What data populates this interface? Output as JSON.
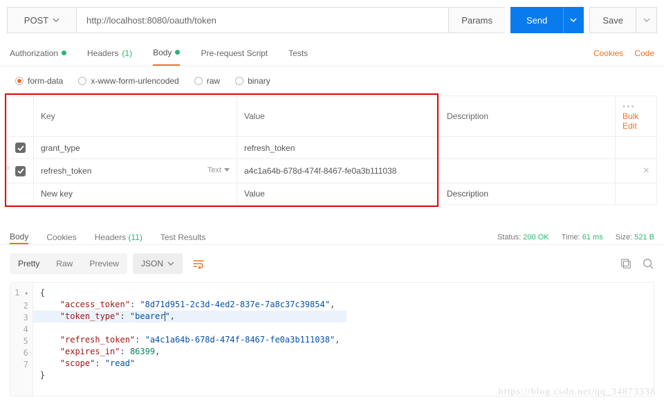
{
  "request": {
    "method": "POST",
    "url": "http://localhost:8080/oauth/token",
    "params_btn": "Params",
    "send_btn": "Send",
    "save_btn": "Save"
  },
  "req_tabs": {
    "authorization": "Authorization",
    "headers": "Headers",
    "headers_count": "(1)",
    "body": "Body",
    "prerequest": "Pre-request Script",
    "tests": "Tests",
    "cookies_link": "Cookies",
    "code_link": "Code"
  },
  "body_types": {
    "form_data": "form-data",
    "xwww": "x-www-form-urlencoded",
    "raw": "raw",
    "binary": "binary"
  },
  "fd": {
    "headers": {
      "key": "Key",
      "value": "Value",
      "desc": "Description",
      "bulk": "Bulk Edit"
    },
    "rows": [
      {
        "key": "grant_type",
        "value": "refresh_token"
      },
      {
        "key": "refresh_token",
        "value": "a4c1a64b-678d-474f-8467-fe0a3b111038",
        "type": "Text"
      }
    ],
    "placeholders": {
      "key": "New key",
      "value": "Value",
      "desc": "Description"
    }
  },
  "resp_tabs": {
    "body": "Body",
    "cookies": "Cookies",
    "headers": "Headers",
    "headers_count": "(11)",
    "tests": "Test Results"
  },
  "resp_meta": {
    "status_lbl": "Status:",
    "status_val": "200 OK",
    "time_lbl": "Time:",
    "time_val": "61 ms",
    "size_lbl": "Size:",
    "size_val": "521 B"
  },
  "resp_toolbar": {
    "pretty": "Pretty",
    "raw": "Raw",
    "preview": "Preview",
    "lang": "JSON"
  },
  "response_body": {
    "access_token": "8d71d951-2c3d-4ed2-837e-7a8c37c39854",
    "token_type": "bearer",
    "refresh_token": "a4c1a64b-678d-474f-8467-fe0a3b111038",
    "expires_in": 86399,
    "scope": "read"
  },
  "watermark": "https://blog.csdn.net/qq_34873338"
}
